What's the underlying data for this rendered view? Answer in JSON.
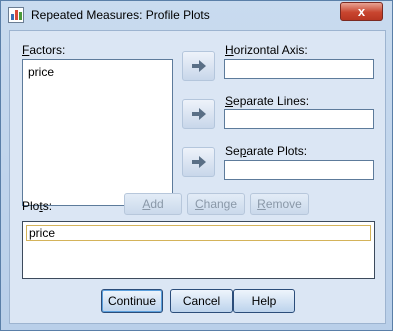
{
  "window": {
    "title": "Repeated Measures: Profile Plots",
    "close_glyph": "x"
  },
  "factors": {
    "label_accel": "F",
    "label_rest": "actors:",
    "items": [
      "price"
    ]
  },
  "horizontal_axis": {
    "label_accel": "H",
    "label_rest": "orizontal Axis:",
    "value": ""
  },
  "separate_lines": {
    "label_accel": "S",
    "label_rest": "eparate Lines:",
    "value": ""
  },
  "separate_plots": {
    "label_pre": "Se",
    "label_accel": "p",
    "label_rest": "arate Plots:",
    "value": ""
  },
  "plots": {
    "label_pre": "Plo",
    "label_accel": "t",
    "label_rest": "s:",
    "add": {
      "accel": "A",
      "rest": "dd"
    },
    "change": {
      "accel": "C",
      "rest": "hange"
    },
    "remove": {
      "accel": "R",
      "rest": "emove"
    },
    "items": [
      "price"
    ]
  },
  "buttons": {
    "continue": "Continue",
    "cancel": "Cancel",
    "help": "Help"
  },
  "icons": {
    "move_arrow": "right-arrow-icon",
    "app": "chart-app-icon"
  },
  "colors": {
    "arrow": "#5a6f86",
    "disabled_text": "#8a98a8",
    "close_red": "#c8452f"
  }
}
